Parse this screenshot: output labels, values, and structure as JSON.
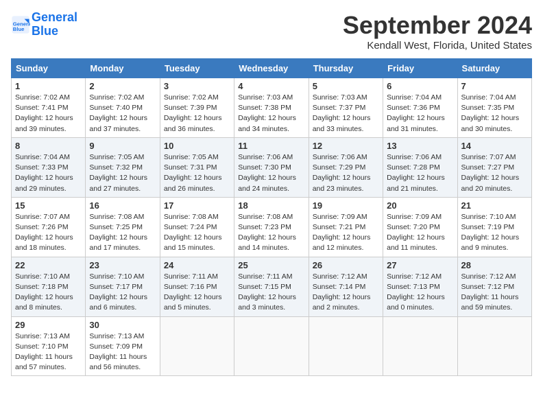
{
  "header": {
    "logo_line1": "General",
    "logo_line2": "Blue",
    "month": "September 2024",
    "location": "Kendall West, Florida, United States"
  },
  "days_of_week": [
    "Sunday",
    "Monday",
    "Tuesday",
    "Wednesday",
    "Thursday",
    "Friday",
    "Saturday"
  ],
  "weeks": [
    [
      {
        "day": "1",
        "info": "Sunrise: 7:02 AM\nSunset: 7:41 PM\nDaylight: 12 hours\nand 39 minutes."
      },
      {
        "day": "2",
        "info": "Sunrise: 7:02 AM\nSunset: 7:40 PM\nDaylight: 12 hours\nand 37 minutes."
      },
      {
        "day": "3",
        "info": "Sunrise: 7:02 AM\nSunset: 7:39 PM\nDaylight: 12 hours\nand 36 minutes."
      },
      {
        "day": "4",
        "info": "Sunrise: 7:03 AM\nSunset: 7:38 PM\nDaylight: 12 hours\nand 34 minutes."
      },
      {
        "day": "5",
        "info": "Sunrise: 7:03 AM\nSunset: 7:37 PM\nDaylight: 12 hours\nand 33 minutes."
      },
      {
        "day": "6",
        "info": "Sunrise: 7:04 AM\nSunset: 7:36 PM\nDaylight: 12 hours\nand 31 minutes."
      },
      {
        "day": "7",
        "info": "Sunrise: 7:04 AM\nSunset: 7:35 PM\nDaylight: 12 hours\nand 30 minutes."
      }
    ],
    [
      {
        "day": "8",
        "info": "Sunrise: 7:04 AM\nSunset: 7:33 PM\nDaylight: 12 hours\nand 29 minutes."
      },
      {
        "day": "9",
        "info": "Sunrise: 7:05 AM\nSunset: 7:32 PM\nDaylight: 12 hours\nand 27 minutes."
      },
      {
        "day": "10",
        "info": "Sunrise: 7:05 AM\nSunset: 7:31 PM\nDaylight: 12 hours\nand 26 minutes."
      },
      {
        "day": "11",
        "info": "Sunrise: 7:06 AM\nSunset: 7:30 PM\nDaylight: 12 hours\nand 24 minutes."
      },
      {
        "day": "12",
        "info": "Sunrise: 7:06 AM\nSunset: 7:29 PM\nDaylight: 12 hours\nand 23 minutes."
      },
      {
        "day": "13",
        "info": "Sunrise: 7:06 AM\nSunset: 7:28 PM\nDaylight: 12 hours\nand 21 minutes."
      },
      {
        "day": "14",
        "info": "Sunrise: 7:07 AM\nSunset: 7:27 PM\nDaylight: 12 hours\nand 20 minutes."
      }
    ],
    [
      {
        "day": "15",
        "info": "Sunrise: 7:07 AM\nSunset: 7:26 PM\nDaylight: 12 hours\nand 18 minutes."
      },
      {
        "day": "16",
        "info": "Sunrise: 7:08 AM\nSunset: 7:25 PM\nDaylight: 12 hours\nand 17 minutes."
      },
      {
        "day": "17",
        "info": "Sunrise: 7:08 AM\nSunset: 7:24 PM\nDaylight: 12 hours\nand 15 minutes."
      },
      {
        "day": "18",
        "info": "Sunrise: 7:08 AM\nSunset: 7:23 PM\nDaylight: 12 hours\nand 14 minutes."
      },
      {
        "day": "19",
        "info": "Sunrise: 7:09 AM\nSunset: 7:21 PM\nDaylight: 12 hours\nand 12 minutes."
      },
      {
        "day": "20",
        "info": "Sunrise: 7:09 AM\nSunset: 7:20 PM\nDaylight: 12 hours\nand 11 minutes."
      },
      {
        "day": "21",
        "info": "Sunrise: 7:10 AM\nSunset: 7:19 PM\nDaylight: 12 hours\nand 9 minutes."
      }
    ],
    [
      {
        "day": "22",
        "info": "Sunrise: 7:10 AM\nSunset: 7:18 PM\nDaylight: 12 hours\nand 8 minutes."
      },
      {
        "day": "23",
        "info": "Sunrise: 7:10 AM\nSunset: 7:17 PM\nDaylight: 12 hours\nand 6 minutes."
      },
      {
        "day": "24",
        "info": "Sunrise: 7:11 AM\nSunset: 7:16 PM\nDaylight: 12 hours\nand 5 minutes."
      },
      {
        "day": "25",
        "info": "Sunrise: 7:11 AM\nSunset: 7:15 PM\nDaylight: 12 hours\nand 3 minutes."
      },
      {
        "day": "26",
        "info": "Sunrise: 7:12 AM\nSunset: 7:14 PM\nDaylight: 12 hours\nand 2 minutes."
      },
      {
        "day": "27",
        "info": "Sunrise: 7:12 AM\nSunset: 7:13 PM\nDaylight: 12 hours\nand 0 minutes."
      },
      {
        "day": "28",
        "info": "Sunrise: 7:12 AM\nSunset: 7:12 PM\nDaylight: 11 hours\nand 59 minutes."
      }
    ],
    [
      {
        "day": "29",
        "info": "Sunrise: 7:13 AM\nSunset: 7:10 PM\nDaylight: 11 hours\nand 57 minutes."
      },
      {
        "day": "30",
        "info": "Sunrise: 7:13 AM\nSunset: 7:09 PM\nDaylight: 11 hours\nand 56 minutes."
      },
      {
        "day": "",
        "info": ""
      },
      {
        "day": "",
        "info": ""
      },
      {
        "day": "",
        "info": ""
      },
      {
        "day": "",
        "info": ""
      },
      {
        "day": "",
        "info": ""
      }
    ]
  ]
}
